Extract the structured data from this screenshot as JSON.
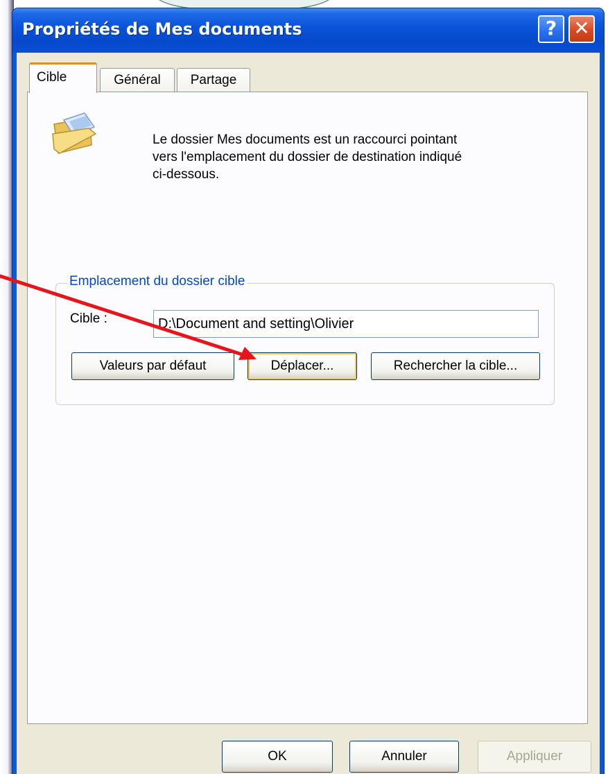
{
  "window": {
    "title": "Propriétés de Mes documents",
    "help_symbol": "?",
    "close_symbol": "✕"
  },
  "tabs": [
    {
      "label": "Cible",
      "selected": true
    },
    {
      "label": "Général",
      "selected": false
    },
    {
      "label": "Partage",
      "selected": false
    }
  ],
  "cible_tab": {
    "description": "Le dossier Mes documents est un raccourci pointant\nvers l'emplacement du dossier de destination indiqué\nci-dessous.",
    "group_title": "Emplacement du dossier cible",
    "target_label": "Cible :",
    "target_value": "D:\\Document and setting\\Olivier",
    "buttons": {
      "defaut": "Valeurs par défaut",
      "deplacer": "Déplacer...",
      "rechercher": "Rechercher la cible..."
    }
  },
  "footer": {
    "ok": "OK",
    "annuler": "Annuler",
    "appliquer": "Appliquer"
  },
  "colors": {
    "titlebar": "#0a55d9",
    "arrow": "#e8141c",
    "group_title": "#0046d5"
  },
  "icons": [
    "folder-icon",
    "help-icon",
    "close-icon"
  ]
}
